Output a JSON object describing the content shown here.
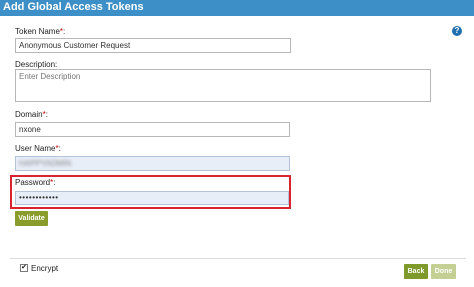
{
  "dialog": {
    "title": "Add Global Access Tokens",
    "help_glyph": "?"
  },
  "form": {
    "token_name": {
      "label": "Token Name",
      "required_mark": "*",
      "label_suffix": ":",
      "value": "Anonymous Customer Request"
    },
    "description": {
      "label": "Description:",
      "placeholder": "Enter Description"
    },
    "domain": {
      "label": "Domain",
      "required_mark": "*",
      "label_suffix": ":",
      "value": "nxone"
    },
    "user_name": {
      "label": "User Name",
      "required_mark": "*",
      "label_suffix": ":",
      "value": "HAPPYADMIN"
    },
    "password": {
      "label": "Password",
      "required_mark": "*",
      "label_suffix": ":",
      "value": "••••••••••••"
    },
    "validate_label": "Validate"
  },
  "footer": {
    "encrypt_label": "Encrypt",
    "encrypt_checked": true,
    "check_glyph": "✔",
    "back_label": "Back",
    "done_label": "Done"
  },
  "colors": {
    "titlebar": "#3d8fc7",
    "button_green": "#8a9c2b",
    "button_disabled": "#c3cf93",
    "highlight_red": "#d9232e",
    "required_red": "#cc0000"
  }
}
